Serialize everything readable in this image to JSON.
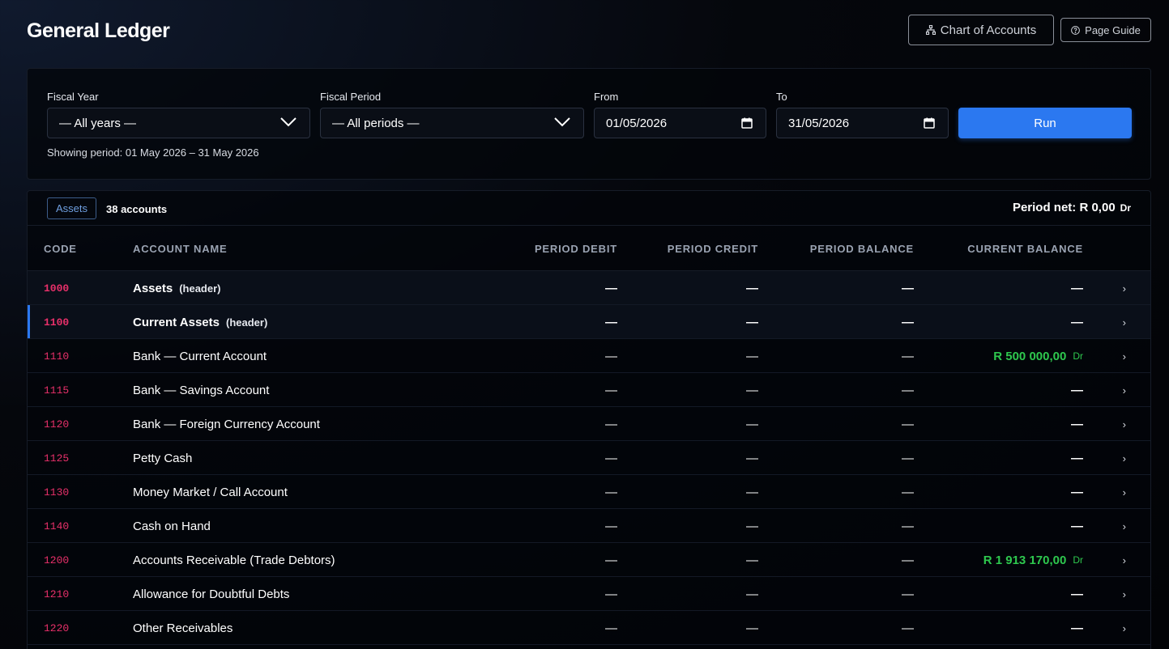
{
  "page": {
    "title": "General Ledger"
  },
  "header": {
    "chart_of_accounts_label": "Chart of Accounts",
    "page_guide_label": "Page Guide"
  },
  "filters": {
    "fiscal_year_label": "Fiscal Year",
    "fiscal_year_value": "— All years —",
    "fiscal_period_label": "Fiscal Period",
    "fiscal_period_value": "— All periods —",
    "from_label": "From",
    "from_value": "01/05/2026",
    "to_label": "To",
    "to_value": "31/05/2026",
    "run_label": "Run",
    "showing_period": "Showing period: 01 May 2026 – 31 May 2026"
  },
  "summary": {
    "category_badge": "Assets",
    "account_count": "38 accounts",
    "period_net_label": "Period net: R 0,00",
    "period_net_suffix": "Dr"
  },
  "columns": {
    "code": "CODE",
    "name": "ACCOUNT NAME",
    "debit": "PERIOD DEBIT",
    "credit": "PERIOD CREDIT",
    "period_balance": "PERIOD BALANCE",
    "current_balance": "CURRENT BALANCE"
  },
  "rows": [
    {
      "code": "1000",
      "name": "Assets",
      "tag": "(header)",
      "debit": "—",
      "credit": "—",
      "period_balance": "—",
      "current_balance": "—",
      "suffix": "",
      "arrow": "›"
    },
    {
      "code": "1100",
      "name": "Current Assets",
      "tag": "(header)",
      "debit": "—",
      "credit": "—",
      "period_balance": "—",
      "current_balance": "—",
      "suffix": "",
      "arrow": "›"
    },
    {
      "code": "1110",
      "name": "Bank — Current Account",
      "tag": "",
      "debit": "—",
      "credit": "—",
      "period_balance": "—",
      "current_balance": "R 500 000,00",
      "suffix": "Dr",
      "arrow": "›"
    },
    {
      "code": "1115",
      "name": "Bank — Savings Account",
      "tag": "",
      "debit": "—",
      "credit": "—",
      "period_balance": "—",
      "current_balance": "—",
      "suffix": "",
      "arrow": "›"
    },
    {
      "code": "1120",
      "name": "Bank — Foreign Currency Account",
      "tag": "",
      "debit": "—",
      "credit": "—",
      "period_balance": "—",
      "current_balance": "—",
      "suffix": "",
      "arrow": "›"
    },
    {
      "code": "1125",
      "name": "Petty Cash",
      "tag": "",
      "debit": "—",
      "credit": "—",
      "period_balance": "—",
      "current_balance": "—",
      "suffix": "",
      "arrow": "›"
    },
    {
      "code": "1130",
      "name": "Money Market / Call Account",
      "tag": "",
      "debit": "—",
      "credit": "—",
      "period_balance": "—",
      "current_balance": "—",
      "suffix": "",
      "arrow": "›"
    },
    {
      "code": "1140",
      "name": "Cash on Hand",
      "tag": "",
      "debit": "—",
      "credit": "—",
      "period_balance": "—",
      "current_balance": "—",
      "suffix": "",
      "arrow": "›"
    },
    {
      "code": "1200",
      "name": "Accounts Receivable (Trade Debtors)",
      "tag": "",
      "debit": "—",
      "credit": "—",
      "period_balance": "—",
      "current_balance": "R 1 913 170,00",
      "suffix": "Dr",
      "arrow": "›"
    },
    {
      "code": "1210",
      "name": "Allowance for Doubtful Debts",
      "tag": "",
      "debit": "—",
      "credit": "—",
      "period_balance": "—",
      "current_balance": "—",
      "suffix": "",
      "arrow": "›"
    },
    {
      "code": "1220",
      "name": "Other Receivables",
      "tag": "",
      "debit": "—",
      "credit": "—",
      "period_balance": "—",
      "current_balance": "—",
      "suffix": "",
      "arrow": "›"
    }
  ],
  "colors": {
    "accent": "#2b78f0",
    "code": "#e8306a",
    "positive": "#2ec84e"
  }
}
